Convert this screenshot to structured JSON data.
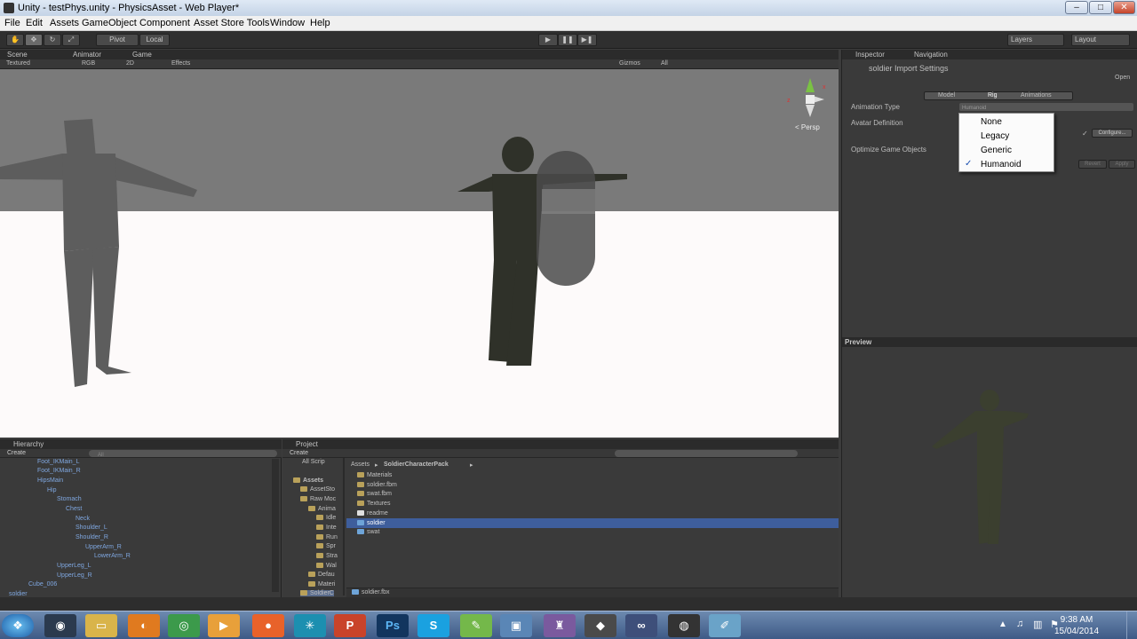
{
  "window": {
    "title": "Unity - testPhys.unity - PhysicsAsset - Web Player*"
  },
  "menu": [
    "File",
    "Edit",
    "Assets",
    "GameObject",
    "Component",
    "Asset Store Tools",
    "Window",
    "Help"
  ],
  "toolbar": {
    "pivot": "Pivot",
    "local": "Local",
    "layers": "Layers",
    "layout": "Layout"
  },
  "scene": {
    "tabs": [
      "Scene",
      "Animator",
      "Game"
    ],
    "bar": {
      "shading": "Textured",
      "rgb": "RGB",
      "mode2d": "2D",
      "effects": "Effects",
      "gizmos": "Gizmos",
      "search": "All"
    },
    "persp": "< Persp"
  },
  "inspector": {
    "tabs": [
      "Inspector",
      "Navigation"
    ],
    "header": "soldier Import Settings",
    "open": "Open",
    "subtabs": [
      "Model",
      "Rig",
      "Animations"
    ],
    "animation_type_label": "Animation Type",
    "animation_type_value": "Humanoid",
    "avatar_definition_label": "Avatar Definition",
    "optimize_label": "Optimize Game Objects",
    "configure": "Configure...",
    "revert": "Revert",
    "apply": "Apply",
    "dropdown": [
      "None",
      "Legacy",
      "Generic",
      "Humanoid"
    ],
    "selected": "Humanoid"
  },
  "preview": {
    "label": "Preview"
  },
  "hierarchy": {
    "title": "Hierarchy",
    "create": "Create",
    "search": "All",
    "items": [
      "Foot_IKMain_L",
      "Foot_IKMain_R",
      "HipsMain",
      "Hip",
      "Stomach",
      "Chest",
      "Neck",
      "Shoulder_L",
      "Shoulder_R",
      "UpperArm_R",
      "LowerArm_R",
      "UpperLeg_L",
      "UpperLeg_R",
      "Cube_006",
      "soldier"
    ]
  },
  "project": {
    "title": "Project",
    "create": "Create",
    "tree": [
      "All Scrip",
      "Assets",
      "AssetSto",
      "Raw Moc",
      "Anima",
      "Idle",
      "Inte",
      "Run",
      "Spr",
      "Stra",
      "Wal",
      "Defau",
      "Materi",
      "SoldierC"
    ],
    "breadcrumb": [
      "Assets",
      "SoldierCharacterPack"
    ],
    "files": [
      "Materials",
      "soldier.fbm",
      "swat.fbm",
      "Textures",
      "readme",
      "soldier",
      "swat"
    ],
    "selected": "soldier",
    "footer": "soldier.fbx"
  },
  "taskbar": {
    "time": "9:38 AM",
    "date": "15/04/2014",
    "ps": "Ps"
  }
}
